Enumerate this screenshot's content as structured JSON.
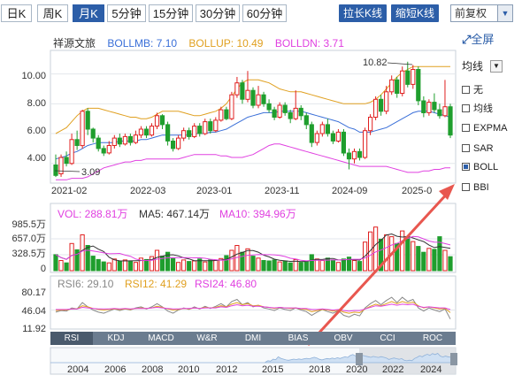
{
  "toolbar": {
    "periods": [
      {
        "label": "日K",
        "active": false
      },
      {
        "label": "周K",
        "active": false
      },
      {
        "label": "月K",
        "active": true
      },
      {
        "label": "5分钟",
        "active": false
      },
      {
        "label": "15分钟",
        "active": false
      },
      {
        "label": "30分钟",
        "active": false
      },
      {
        "label": "60分钟",
        "active": false
      }
    ],
    "stretch_label": "拉长K线",
    "shrink_label": "缩短K线",
    "adjust_label": "前复权",
    "fullscreen_label": "全屏"
  },
  "legend": {
    "stock_name": "祥源文旅",
    "boll_mb": "BOLLMB: 7.10",
    "boll_up": "BOLLUP: 10.49",
    "boll_dn": "BOLLDN: 3.71"
  },
  "colors": {
    "up": "#e02020",
    "down": "#1f9e2d",
    "mb": "#3a6fd8",
    "upper": "#e0a020",
    "lower": "#e040e0",
    "accent": "#2c5ea8",
    "arrow": "#e8574f"
  },
  "right_panel": {
    "indicator_select": "均线",
    "options": [
      {
        "label": "无",
        "checked": false
      },
      {
        "label": "均线",
        "checked": false
      },
      {
        "label": "EXPMA",
        "checked": false
      },
      {
        "label": "SAR",
        "checked": false
      },
      {
        "label": "BOLL",
        "checked": true
      },
      {
        "label": "BBI",
        "checked": false
      }
    ]
  },
  "price_chart": {
    "y_ticks": [
      "10.00",
      "8.00",
      "6.00",
      "4.00"
    ],
    "x_ticks": [
      "2021-02",
      "2022-03",
      "2023-01",
      "2023-11",
      "2024-09",
      "2025-0"
    ],
    "max_label": "10.82",
    "min_label": "3.09"
  },
  "volume_chart": {
    "legend": {
      "vol": "VOL: 288.81万",
      "ma5": "MA5: 467.14万",
      "ma10": "MA10: 394.96万"
    },
    "y_ticks": [
      "985.5万",
      "657.0万",
      "328.5万",
      "0"
    ]
  },
  "rsi_chart": {
    "legend": {
      "rsi6": "RSI6: 29.10",
      "rsi12": "RSI12: 41.29",
      "rsi24": "RSI24: 46.80"
    },
    "y_ticks": [
      "80.17",
      "46.04",
      "11.92"
    ]
  },
  "indicator_tabs": [
    "RSI",
    "KDJ",
    "MACD",
    "W&R",
    "DMI",
    "BIAS",
    "OBV",
    "CCI",
    "ROC"
  ],
  "timeline": {
    "years": [
      "2004",
      "2006",
      "2008",
      "2010",
      "2012",
      "2015",
      "2018",
      "2020",
      "2022",
      "2024"
    ]
  },
  "chart_data": {
    "type": "candlestick",
    "title": "祥源文旅",
    "period": "monthly",
    "price_range": [
      2.8,
      11.4
    ],
    "candles": [
      {
        "o": 3.9,
        "c": 3.2,
        "h": 4.6,
        "l": 3.09
      },
      {
        "o": 3.3,
        "c": 4.4,
        "h": 4.6,
        "l": 3.1
      },
      {
        "o": 4.4,
        "c": 4.0,
        "h": 4.8,
        "l": 3.8
      },
      {
        "o": 4.0,
        "c": 5.6,
        "h": 6.0,
        "l": 3.9
      },
      {
        "o": 5.6,
        "c": 5.2,
        "h": 6.2,
        "l": 4.9
      },
      {
        "o": 5.2,
        "c": 7.5,
        "h": 7.6,
        "l": 5.0
      },
      {
        "o": 7.5,
        "c": 6.3,
        "h": 7.7,
        "l": 5.9
      },
      {
        "o": 6.3,
        "c": 5.7,
        "h": 6.4,
        "l": 5.4
      },
      {
        "o": 5.7,
        "c": 5.0,
        "h": 5.9,
        "l": 4.8
      },
      {
        "o": 5.0,
        "c": 4.7,
        "h": 5.2,
        "l": 4.5
      },
      {
        "o": 4.7,
        "c": 5.2,
        "h": 5.5,
        "l": 4.6
      },
      {
        "o": 5.2,
        "c": 5.7,
        "h": 5.9,
        "l": 5.0
      },
      {
        "o": 5.7,
        "c": 5.3,
        "h": 6.0,
        "l": 5.1
      },
      {
        "o": 5.3,
        "c": 5.8,
        "h": 6.0,
        "l": 5.2
      },
      {
        "o": 5.8,
        "c": 5.4,
        "h": 6.0,
        "l": 5.2
      },
      {
        "o": 5.4,
        "c": 5.9,
        "h": 6.2,
        "l": 5.3
      },
      {
        "o": 5.9,
        "c": 6.3,
        "h": 6.5,
        "l": 5.7
      },
      {
        "o": 6.3,
        "c": 5.9,
        "h": 6.5,
        "l": 5.7
      },
      {
        "o": 5.9,
        "c": 6.5,
        "h": 6.7,
        "l": 5.8
      },
      {
        "o": 6.5,
        "c": 7.2,
        "h": 7.4,
        "l": 6.3
      },
      {
        "o": 7.2,
        "c": 6.6,
        "h": 7.3,
        "l": 6.3
      },
      {
        "o": 6.6,
        "c": 5.5,
        "h": 6.8,
        "l": 5.2
      },
      {
        "o": 5.5,
        "c": 5.0,
        "h": 5.7,
        "l": 4.8
      },
      {
        "o": 5.0,
        "c": 5.7,
        "h": 5.9,
        "l": 4.9
      },
      {
        "o": 5.7,
        "c": 6.2,
        "h": 6.4,
        "l": 5.5
      },
      {
        "o": 6.2,
        "c": 5.8,
        "h": 6.4,
        "l": 5.6
      },
      {
        "o": 5.8,
        "c": 6.5,
        "h": 6.7,
        "l": 5.7
      },
      {
        "o": 6.5,
        "c": 6.0,
        "h": 6.7,
        "l": 5.8
      },
      {
        "o": 6.0,
        "c": 6.8,
        "h": 7.0,
        "l": 5.9
      },
      {
        "o": 6.8,
        "c": 6.2,
        "h": 7.0,
        "l": 6.0
      },
      {
        "o": 6.2,
        "c": 6.9,
        "h": 7.1,
        "l": 6.1
      },
      {
        "o": 6.9,
        "c": 7.6,
        "h": 7.8,
        "l": 6.8
      },
      {
        "o": 7.6,
        "c": 7.0,
        "h": 7.8,
        "l": 6.9
      },
      {
        "o": 7.0,
        "c": 8.6,
        "h": 8.8,
        "l": 6.9
      },
      {
        "o": 8.6,
        "c": 9.4,
        "h": 9.8,
        "l": 8.4
      },
      {
        "o": 9.4,
        "c": 8.3,
        "h": 9.6,
        "l": 8.0
      },
      {
        "o": 8.3,
        "c": 8.9,
        "h": 10.2,
        "l": 8.1
      },
      {
        "o": 8.9,
        "c": 7.9,
        "h": 9.1,
        "l": 7.7
      },
      {
        "o": 7.9,
        "c": 8.6,
        "h": 9.2,
        "l": 7.7
      },
      {
        "o": 8.6,
        "c": 8.0,
        "h": 8.8,
        "l": 7.8
      },
      {
        "o": 8.0,
        "c": 7.6,
        "h": 8.3,
        "l": 7.4
      },
      {
        "o": 7.6,
        "c": 7.1,
        "h": 7.8,
        "l": 6.9
      },
      {
        "o": 7.1,
        "c": 7.9,
        "h": 8.1,
        "l": 7.0
      },
      {
        "o": 7.9,
        "c": 7.4,
        "h": 8.1,
        "l": 7.2
      },
      {
        "o": 7.4,
        "c": 7.0,
        "h": 7.6,
        "l": 6.7
      },
      {
        "o": 7.0,
        "c": 7.7,
        "h": 8.9,
        "l": 6.9
      },
      {
        "o": 7.7,
        "c": 7.2,
        "h": 7.9,
        "l": 6.9
      },
      {
        "o": 7.2,
        "c": 6.6,
        "h": 7.4,
        "l": 6.3
      },
      {
        "o": 6.6,
        "c": 5.4,
        "h": 6.8,
        "l": 5.1
      },
      {
        "o": 5.4,
        "c": 6.0,
        "h": 6.2,
        "l": 5.2
      },
      {
        "o": 6.0,
        "c": 6.6,
        "h": 6.8,
        "l": 5.8
      },
      {
        "o": 6.6,
        "c": 6.0,
        "h": 7.0,
        "l": 5.8
      },
      {
        "o": 6.0,
        "c": 5.5,
        "h": 6.2,
        "l": 5.3
      },
      {
        "o": 5.5,
        "c": 6.1,
        "h": 6.3,
        "l": 5.4
      },
      {
        "o": 6.1,
        "c": 4.7,
        "h": 6.3,
        "l": 4.5
      },
      {
        "o": 4.7,
        "c": 4.3,
        "h": 5.0,
        "l": 3.6
      },
      {
        "o": 4.3,
        "c": 4.8,
        "h": 5.0,
        "l": 4.0
      },
      {
        "o": 4.8,
        "c": 4.4,
        "h": 5.0,
        "l": 4.2
      },
      {
        "o": 4.4,
        "c": 6.2,
        "h": 6.4,
        "l": 4.3
      },
      {
        "o": 6.2,
        "c": 7.1,
        "h": 7.3,
        "l": 5.9
      },
      {
        "o": 7.1,
        "c": 8.3,
        "h": 8.5,
        "l": 6.9
      },
      {
        "o": 8.3,
        "c": 7.5,
        "h": 8.6,
        "l": 7.2
      },
      {
        "o": 7.5,
        "c": 8.8,
        "h": 9.2,
        "l": 7.3
      },
      {
        "o": 8.8,
        "c": 9.6,
        "h": 9.9,
        "l": 8.6
      },
      {
        "o": 9.6,
        "c": 8.7,
        "h": 9.8,
        "l": 8.4
      },
      {
        "o": 8.7,
        "c": 10.2,
        "h": 10.5,
        "l": 8.5
      },
      {
        "o": 10.2,
        "c": 9.3,
        "h": 10.82,
        "l": 9.1
      },
      {
        "o": 9.3,
        "c": 10.3,
        "h": 10.6,
        "l": 9.0
      },
      {
        "o": 10.3,
        "c": 8.2,
        "h": 10.5,
        "l": 7.9
      },
      {
        "o": 8.2,
        "c": 7.4,
        "h": 8.5,
        "l": 7.1
      },
      {
        "o": 7.4,
        "c": 8.1,
        "h": 8.3,
        "l": 7.2
      },
      {
        "o": 8.1,
        "c": 7.6,
        "h": 8.7,
        "l": 7.4
      },
      {
        "o": 7.6,
        "c": 7.2,
        "h": 8.0,
        "l": 7.0
      },
      {
        "o": 7.2,
        "c": 7.8,
        "h": 9.6,
        "l": 7.1
      },
      {
        "o": 7.8,
        "c": 5.9,
        "h": 8.0,
        "l": 5.7
      }
    ],
    "boll_mid": [
      4.3,
      4.4,
      4.5,
      4.7,
      4.8,
      5.0,
      5.2,
      5.3,
      5.4,
      5.4,
      5.4,
      5.4,
      5.5,
      5.5,
      5.5,
      5.5,
      5.6,
      5.6,
      5.7,
      5.8,
      5.9,
      5.9,
      5.9,
      5.9,
      5.9,
      5.9,
      6.0,
      6.0,
      6.0,
      6.1,
      6.1,
      6.2,
      6.3,
      6.5,
      6.7,
      6.9,
      7.1,
      7.2,
      7.3,
      7.4,
      7.4,
      7.4,
      7.5,
      7.5,
      7.5,
      7.5,
      7.5,
      7.4,
      7.3,
      7.2,
      7.1,
      7.0,
      6.9,
      6.8,
      6.6,
      6.4,
      6.3,
      6.1,
      6.1,
      6.1,
      6.2,
      6.3,
      6.4,
      6.6,
      6.8,
      7.0,
      7.2,
      7.4,
      7.5,
      7.5,
      7.5,
      7.4,
      7.3,
      7.2,
      7.1
    ],
    "boll_up": [
      6.0,
      6.2,
      6.4,
      6.8,
      7.2,
      7.5,
      7.7,
      7.7,
      7.7,
      7.6,
      7.5,
      7.4,
      7.3,
      7.2,
      7.1,
      7.1,
      7.0,
      7.0,
      7.1,
      7.3,
      7.5,
      7.5,
      7.5,
      7.5,
      7.4,
      7.3,
      7.2,
      7.2,
      7.3,
      7.4,
      7.5,
      7.7,
      8.0,
      8.5,
      9.0,
      9.4,
      9.6,
      9.6,
      9.6,
      9.5,
      9.4,
      9.2,
      9.0,
      8.9,
      8.8,
      8.8,
      8.8,
      8.7,
      8.6,
      8.5,
      8.4,
      8.3,
      8.2,
      8.1,
      8.0,
      8.0,
      8.0,
      8.0,
      8.0,
      8.1,
      8.3,
      8.6,
      9.0,
      9.4,
      9.8,
      10.1,
      10.3,
      10.5,
      10.5,
      10.5,
      10.5,
      10.5,
      10.5,
      10.5,
      10.49
    ],
    "boll_dn": [
      2.9,
      2.9,
      2.9,
      3.0,
      3.0,
      3.0,
      3.1,
      3.3,
      3.5,
      3.7,
      3.8,
      3.9,
      4.0,
      4.1,
      4.1,
      4.2,
      4.2,
      4.3,
      4.3,
      4.3,
      4.3,
      4.3,
      4.3,
      4.3,
      4.4,
      4.5,
      4.6,
      4.6,
      4.6,
      4.6,
      4.6,
      4.5,
      4.5,
      4.4,
      4.4,
      4.4,
      4.5,
      4.6,
      4.8,
      5.0,
      5.2,
      5.3,
      5.3,
      5.2,
      5.1,
      5.0,
      4.9,
      4.8,
      4.7,
      4.6,
      4.5,
      4.4,
      4.3,
      4.2,
      4.1,
      4.0,
      3.9,
      3.8,
      3.8,
      3.8,
      3.8,
      3.8,
      3.8,
      3.7,
      3.6,
      3.5,
      3.4,
      3.4,
      3.4,
      3.5,
      3.5,
      3.6,
      3.6,
      3.7,
      3.71
    ],
    "volume": [
      330,
      210,
      160,
      560,
      430,
      740,
      520,
      300,
      230,
      180,
      160,
      240,
      200,
      220,
      190,
      170,
      260,
      230,
      290,
      420,
      300,
      380,
      250,
      170,
      220,
      190,
      200,
      240,
      180,
      220,
      210,
      250,
      310,
      420,
      520,
      380,
      450,
      300,
      260,
      210,
      200,
      220,
      180,
      200,
      160,
      230,
      170,
      200,
      330,
      240,
      210,
      260,
      220,
      170,
      240,
      280,
      210,
      190,
      590,
      800,
      900,
      650,
      740,
      700,
      560,
      820,
      700,
      600,
      500,
      380,
      460,
      440,
      700,
      420,
      288.81
    ],
    "rsi6": [
      42,
      45,
      44,
      50,
      48,
      60,
      52,
      46,
      42,
      40,
      44,
      48,
      45,
      48,
      46,
      50,
      52,
      48,
      52,
      58,
      52,
      44,
      40,
      46,
      50,
      47,
      52,
      48,
      53,
      49,
      53,
      58,
      52,
      62,
      66,
      56,
      60,
      52,
      55,
      50,
      48,
      45,
      50,
      47,
      45,
      50,
      46,
      43,
      36,
      42,
      47,
      43,
      40,
      45,
      36,
      33,
      38,
      35,
      50,
      58,
      64,
      56,
      64,
      70,
      60,
      70,
      62,
      66,
      50,
      44,
      50,
      46,
      43,
      48,
      29.1
    ],
    "rsi12": [
      45,
      46,
      46,
      48,
      48,
      54,
      52,
      49,
      47,
      46,
      47,
      48,
      47,
      48,
      47,
      49,
      50,
      49,
      50,
      53,
      51,
      48,
      46,
      47,
      49,
      48,
      50,
      49,
      51,
      50,
      51,
      54,
      52,
      57,
      60,
      56,
      58,
      54,
      55,
      52,
      51,
      49,
      51,
      50,
      49,
      50,
      48,
      47,
      43,
      45,
      47,
      46,
      44,
      46,
      42,
      40,
      42,
      41,
      48,
      53,
      57,
      54,
      58,
      62,
      58,
      62,
      59,
      61,
      54,
      50,
      52,
      50,
      48,
      49,
      41.29
    ],
    "rsi24": [
      47,
      47,
      47,
      48,
      48,
      51,
      50,
      49,
      48,
      48,
      48,
      49,
      48,
      49,
      48,
      49,
      49,
      49,
      50,
      51,
      50,
      49,
      48,
      48,
      49,
      49,
      50,
      49,
      50,
      50,
      50,
      52,
      51,
      54,
      56,
      54,
      55,
      53,
      53,
      52,
      51,
      50,
      51,
      50,
      50,
      50,
      49,
      49,
      47,
      47,
      48,
      47,
      46,
      47,
      45,
      44,
      45,
      45,
      48,
      51,
      54,
      53,
      55,
      57,
      55,
      57,
      56,
      57,
      53,
      51,
      52,
      51,
      50,
      50,
      46.8
    ],
    "rsi_range": [
      11.92,
      80.17
    ],
    "volume_max": 985.5
  }
}
